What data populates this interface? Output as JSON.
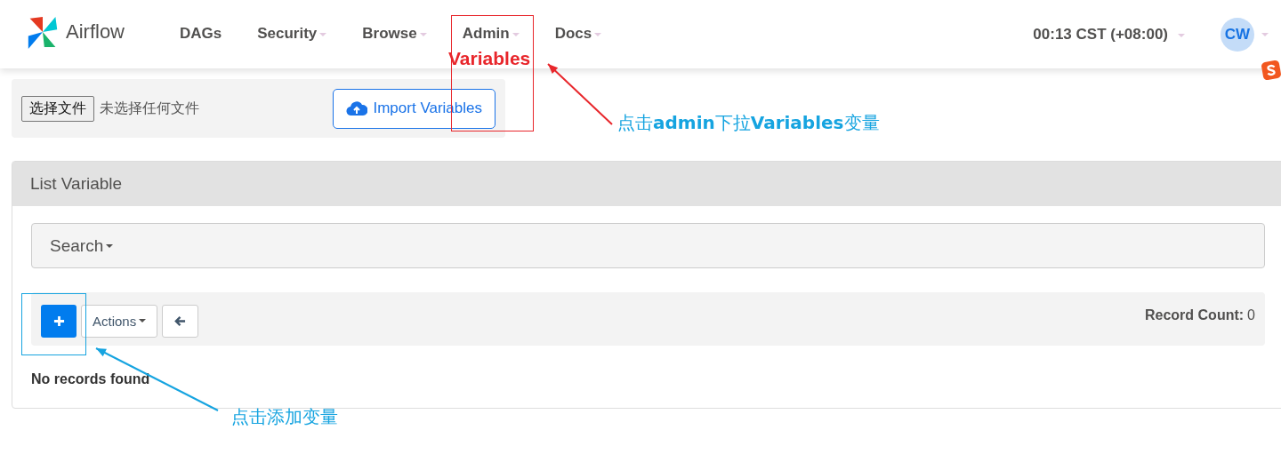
{
  "navbar": {
    "brand": "Airflow",
    "items": [
      {
        "label": "DAGs",
        "dropdown": false
      },
      {
        "label": "Security",
        "dropdown": true
      },
      {
        "label": "Browse",
        "dropdown": true
      },
      {
        "label": "Admin",
        "dropdown": true
      },
      {
        "label": "Docs",
        "dropdown": true
      }
    ],
    "time": "00:13 CST (+08:00)",
    "user_initials": "CW"
  },
  "import_form": {
    "file_button": "选择文件",
    "file_status": "未选择任何文件",
    "import_button": "Import Variables"
  },
  "panel": {
    "title": "List Variable",
    "search": "Search",
    "actions": "Actions",
    "record_count_label": "Record Count:",
    "record_count": "0",
    "empty_message": "No records found"
  },
  "annotations": [
    {
      "kind": "box",
      "color": "#e8262b"
    },
    {
      "kind": "label",
      "text": "Variables",
      "color": "#e8262b"
    },
    {
      "kind": "arrow",
      "color": "#e8262b"
    },
    {
      "kind": "label",
      "text": "点击**admin**下拉**Variables**变量",
      "color": "#16a4e0"
    },
    {
      "kind": "box",
      "color": "#16a4e0"
    },
    {
      "kind": "arrow",
      "color": "#16a4e0"
    },
    {
      "kind": "label",
      "text": "点击添加变量",
      "color": "#16a4e0"
    }
  ]
}
